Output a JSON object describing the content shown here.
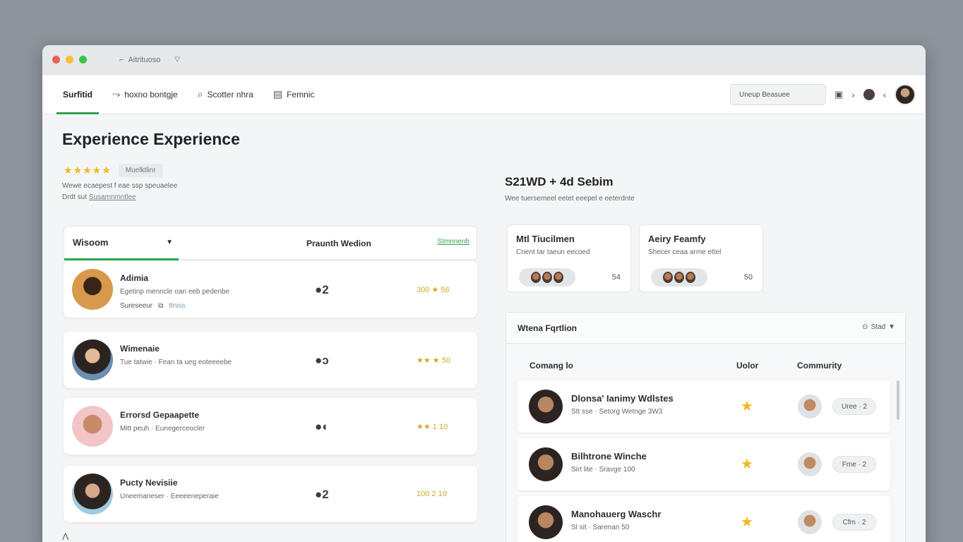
{
  "window": {
    "tab_title": "Aitrituoso"
  },
  "nav": {
    "items": [
      {
        "label": "Surfitid",
        "icon": "home-icon"
      },
      {
        "label": "hoxno bontgje",
        "icon": "share-icon"
      },
      {
        "label": "Scotter nhra",
        "icon": "search-icon"
      },
      {
        "label": "Femnic",
        "icon": "printer-icon"
      }
    ],
    "search_placeholder": "Uneup Beasuee"
  },
  "page": {
    "title": "Experience Experience",
    "stars": "★★★★★",
    "rating_badge": "Muelktlinr",
    "meta_line1": "Wewe ecaepest f eae ssp speuaelee",
    "meta_line2_prefix": "Drdt sut",
    "meta_line2_link": "Susamnmntlee"
  },
  "left_panel": {
    "tab_label": "Wisoom",
    "col_mid": "Praunth Wedion",
    "col_right": "Stmnnenh",
    "people": [
      {
        "name": "Adimia",
        "desc": "Egetinp menncle oan eeb pedenbe",
        "tag": "Sureseeur",
        "tag_link": "ttniss",
        "toggle": "●2",
        "rating": "300 ★ 56"
      },
      {
        "name": "Wimenaie",
        "desc": "Tue tatwie · Fean ta ueg eoteeeebe",
        "toggle": "●ↄ",
        "rating": "★★ ★ 50"
      },
      {
        "name": "Errorsd Gepaapette",
        "desc": "Mitt peuh · Eunegerceocler",
        "toggle": "●◐",
        "rating": "★★ 1 10"
      },
      {
        "name": "Pucty Nevisiie",
        "desc": "Uneemaneser · Eeeeeneperaie",
        "toggle": "●2",
        "rating": "100 2 10"
      }
    ]
  },
  "right": {
    "title": "S21WD + 4d Sebim",
    "subtitle": "Wee tuersemeel eetet eeepel e eeterdnte",
    "mini_cards": [
      {
        "title": "Mtl Tiucilmen",
        "sub": "Cnent tar taeun eecoed",
        "count": "54"
      },
      {
        "title": "Aeiry Feamfy",
        "sub": "Shecer ceaa arme ettel",
        "count": "50"
      }
    ],
    "table": {
      "title": "Wtena Fqrtlion",
      "filter": "Stad",
      "col_1": "Comang lo",
      "col_2": "Uolor",
      "col_3": "Commurity",
      "rows": [
        {
          "name": "Dlonsa' Ianimy Wdlstes",
          "sub": "Stt sse · Setorg Wetnge 3W3",
          "pill": "Uree · 2"
        },
        {
          "name": "Bilhtrone Winche",
          "sub": "Sirt lite · Sravge 100",
          "pill": "Fme · 2"
        },
        {
          "name": "Manohauerg Waschr",
          "sub": "Sl sit · Sarenan 50",
          "pill": "Cfm · 2"
        }
      ]
    }
  },
  "colors": {
    "accent": "#2ea44f",
    "star": "#f0b81c"
  }
}
